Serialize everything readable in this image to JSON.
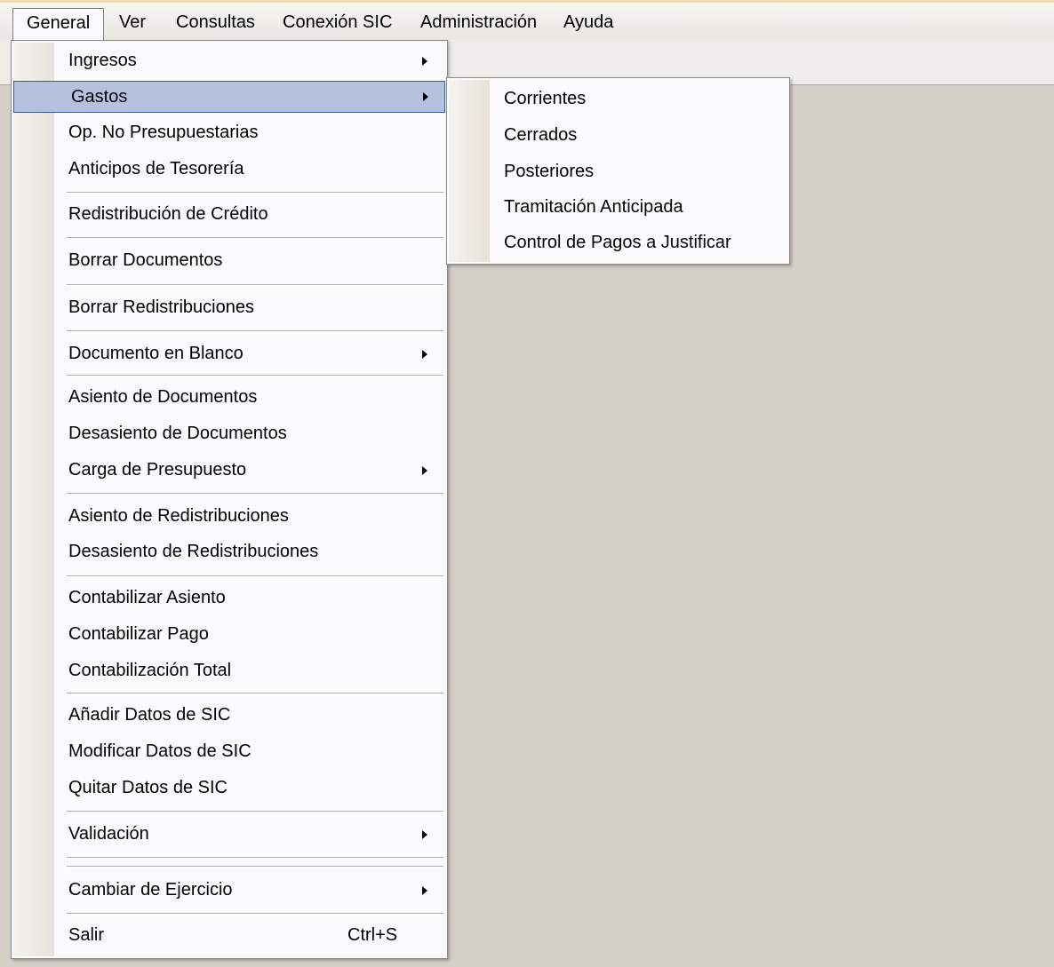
{
  "menubar": {
    "items": [
      {
        "label": "General"
      },
      {
        "label": "Ver"
      },
      {
        "label": "Consultas"
      },
      {
        "label": "Conexión SIC"
      },
      {
        "label": "Administración"
      },
      {
        "label": "Ayuda"
      }
    ]
  },
  "general_menu": {
    "items": [
      {
        "label": "Ingresos"
      },
      {
        "label": "Gastos"
      },
      {
        "label": "Op. No Presupuestarias"
      },
      {
        "label": "Anticipos de Tesorería"
      },
      {
        "label": "Redistribución de Crédito"
      },
      {
        "label": "Borrar Documentos"
      },
      {
        "label": "Borrar Redistribuciones"
      },
      {
        "label": "Documento en Blanco"
      },
      {
        "label": "Asiento de Documentos"
      },
      {
        "label": "Desasiento de Documentos"
      },
      {
        "label": "Carga de Presupuesto"
      },
      {
        "label": "Asiento de Redistribuciones"
      },
      {
        "label": "Desasiento de Redistribuciones"
      },
      {
        "label": "Contabilizar Asiento"
      },
      {
        "label": "Contabilizar Pago"
      },
      {
        "label": "Contabilización Total"
      },
      {
        "label": "Añadir Datos de SIC"
      },
      {
        "label": "Modificar Datos de SIC"
      },
      {
        "label": "Quitar Datos de SIC"
      },
      {
        "label": "Validación"
      },
      {
        "label": "Cambiar de Ejercicio"
      },
      {
        "label": "Salir",
        "shortcut": "Ctrl+S"
      }
    ]
  },
  "gastos_submenu": {
    "items": [
      {
        "label": "Corrientes"
      },
      {
        "label": "Cerrados"
      },
      {
        "label": "Posteriores"
      },
      {
        "label": "Tramitación Anticipada"
      },
      {
        "label": "Control de Pagos a Justificar"
      }
    ]
  },
  "colors": {
    "highlight": "#b4c2df",
    "highlight_border": "#3e5a98",
    "workspace": "#d4d0c8",
    "menu_bg": "#fbfafd"
  }
}
